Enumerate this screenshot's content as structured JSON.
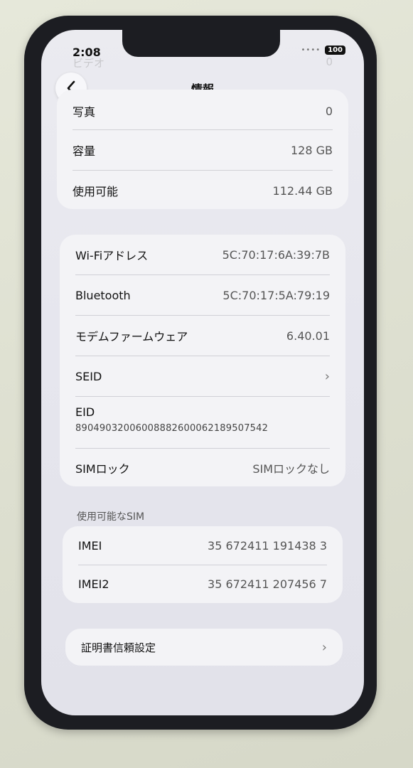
{
  "status": {
    "time": "2:08",
    "battery": "100"
  },
  "ghost_row": {
    "label": "ビデオ",
    "value": "0"
  },
  "nav": {
    "title": "情報"
  },
  "group1": [
    {
      "label": "写真",
      "value": "0"
    },
    {
      "label": "容量",
      "value": "128 GB"
    },
    {
      "label": "使用可能",
      "value": "112.44 GB"
    }
  ],
  "group2": {
    "wifi": {
      "label": "Wi-Fiアドレス",
      "value": "5C:70:17:6A:39:7B"
    },
    "bluetooth": {
      "label": "Bluetooth",
      "value": "5C:70:17:5A:79:19"
    },
    "modem": {
      "label": "モデムファームウェア",
      "value": "6.40.01"
    },
    "seid": {
      "label": "SEID"
    },
    "eid": {
      "label": "EID",
      "value": "89049032006008882600062189507542"
    },
    "simlock": {
      "label": "SIMロック",
      "value": "SIMロックなし"
    }
  },
  "sim_section": {
    "header": "使用可能なSIM",
    "imei": {
      "label": "IMEI",
      "value": "35 672411 191438 3"
    },
    "imei2": {
      "label": "IMEI2",
      "value": "35 672411 207456 7"
    }
  },
  "cert": {
    "label": "証明書信頼設定"
  }
}
